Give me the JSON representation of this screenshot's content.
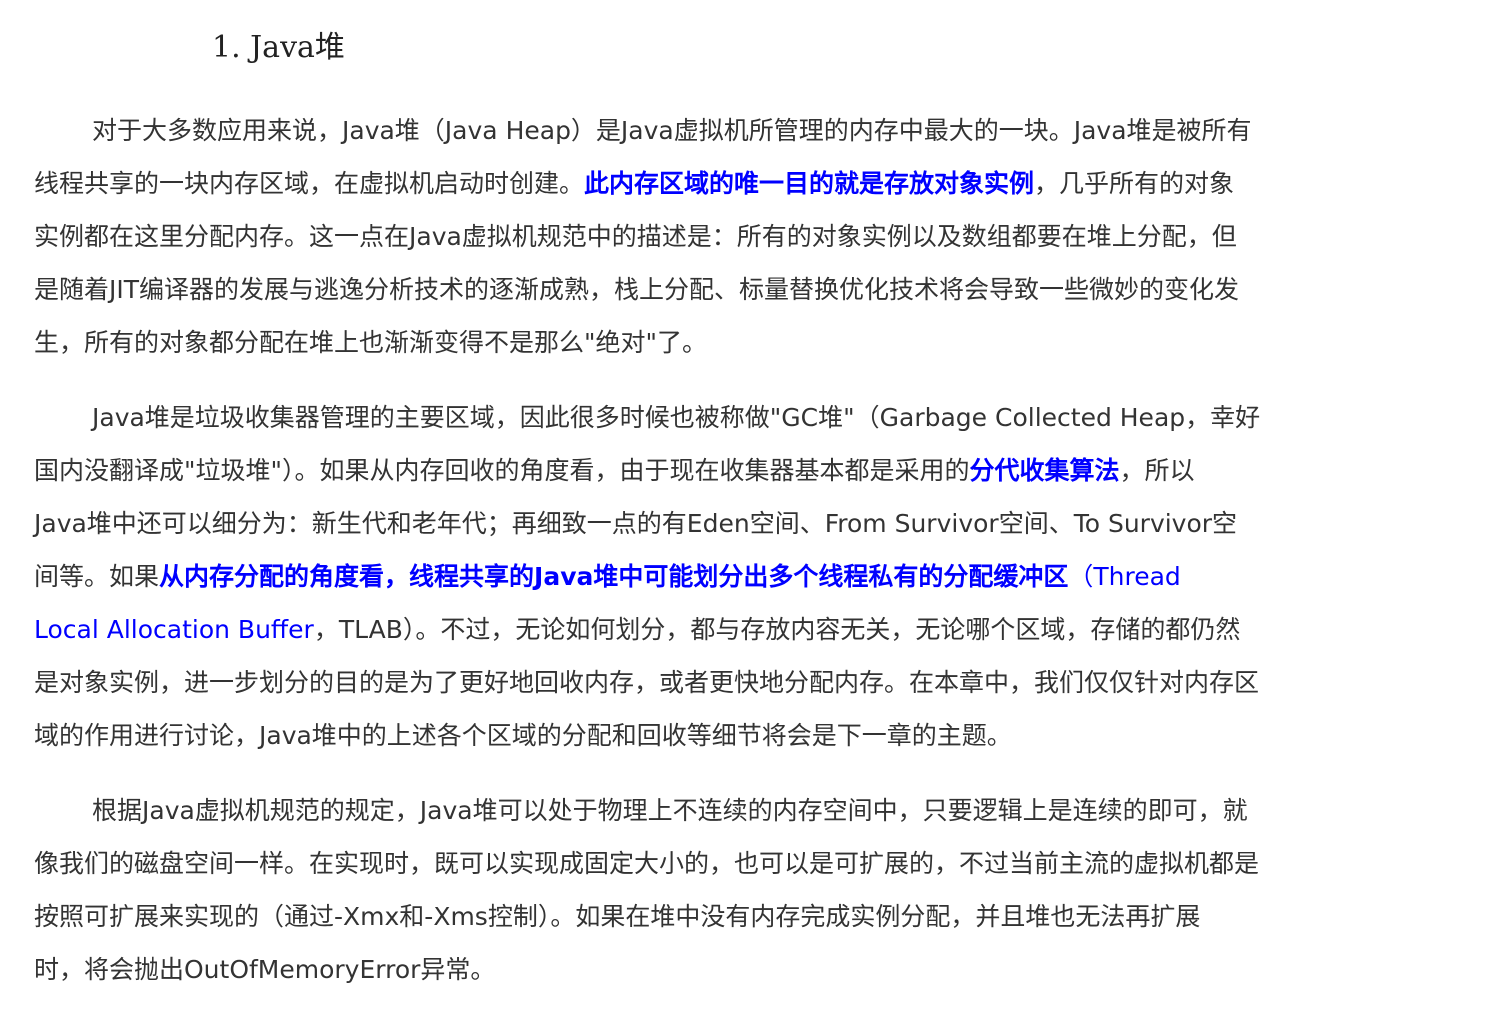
{
  "title": "1. Java堆",
  "colors": {
    "text": "#333333",
    "link": "#0000ff"
  },
  "paragraphs": [
    {
      "lines": [
        [
          {
            "text": "对于大多数应用来说，Java堆（Java Heap）是Java虚拟机所管理的内存中最大的一块。Java堆是被所有"
          }
        ],
        [
          {
            "text": "线程共享的一块内存区域，在虚拟机启动时创建。"
          },
          {
            "text": "此内存区域的唯一目的就是存放对象实例",
            "blue": true,
            "bold": true
          },
          {
            "text": "，几乎所有的对象"
          }
        ],
        [
          {
            "text": "实例都在这里分配内存。这一点在Java虚拟机规范中的描述是：所有的对象实例以及数组都要在堆上分配，但"
          }
        ],
        [
          {
            "text": "是随着JIT编译器的发展与逃逸分析技术的逐渐成熟，栈上分配、标量替换优化技术将会导致一些微妙的变化发"
          }
        ],
        [
          {
            "text": "生，所有的对象都分配在堆上也渐渐变得不是那么\"绝对\"了。"
          }
        ]
      ]
    },
    {
      "lines": [
        [
          {
            "text": "Java堆是垃圾收集器管理的主要区域，因此很多时候也被称做\"GC堆\"（Garbage Collected Heap，幸好"
          }
        ],
        [
          {
            "text": "国内没翻译成\"垃圾堆\"）。如果从内存回收的角度看，由于现在收集器基本都是采用的"
          },
          {
            "text": "分代收集算法",
            "blue": true,
            "bold": true
          },
          {
            "text": "，所以"
          }
        ],
        [
          {
            "text": "Java堆中还可以细分为：新生代和老年代；再细致一点的有Eden空间、From Survivor空间、To Survivor空"
          }
        ],
        [
          {
            "text": "间等。如果"
          },
          {
            "text": "从内存分配的角度看，线程共享的Java堆中可能划分出多个线程私有的分配缓冲区",
            "blue": true,
            "bold": true
          },
          {
            "text": "（Thread",
            "blue": true
          }
        ],
        [
          {
            "text": "Local Allocation Buffer",
            "blue": true
          },
          {
            "text": "，TLAB）。不过，无论如何划分，都与存放内容无关，无论哪个区域，存储的都仍然"
          }
        ],
        [
          {
            "text": "是对象实例，进一步划分的目的是为了更好地回收内存，或者更快地分配内存。在本章中，我们仅仅针对内存区"
          }
        ],
        [
          {
            "text": "域的作用进行讨论，Java堆中的上述各个区域的分配和回收等细节将会是下一章的主题。"
          }
        ]
      ]
    },
    {
      "lines": [
        [
          {
            "text": "根据Java虚拟机规范的规定，Java堆可以处于物理上不连续的内存空间中，只要逻辑上是连续的即可，就"
          }
        ],
        [
          {
            "text": "像我们的磁盘空间一样。在实现时，既可以实现成固定大小的，也可以是可扩展的，不过当前主流的虚拟机都是"
          }
        ],
        [
          {
            "text": "按照可扩展来实现的（通过-Xmx和-Xms控制）。如果在堆中没有内存完成实例分配，并且堆也无法再扩展"
          }
        ],
        [
          {
            "text": "时，将会抛出OutOfMemoryError异常。"
          }
        ]
      ]
    }
  ]
}
